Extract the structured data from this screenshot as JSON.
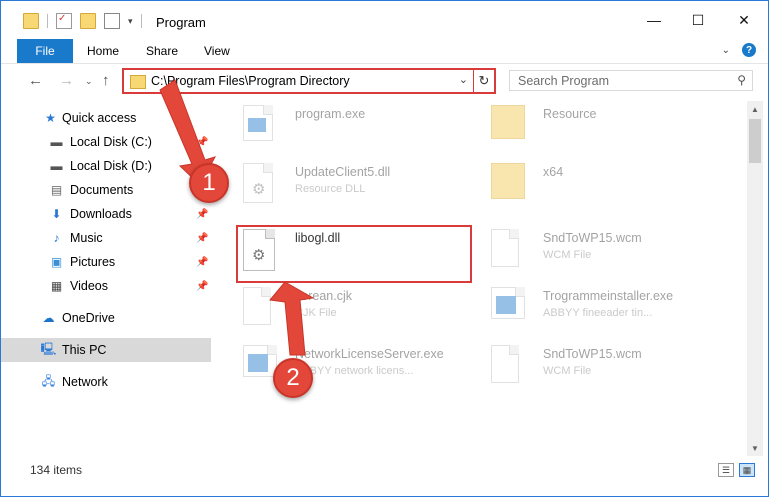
{
  "window": {
    "title": "Program",
    "minimize_label": "—",
    "maximize_label": "☐",
    "close_label": "✕"
  },
  "ribbon": {
    "tabs": [
      "File",
      "Home",
      "Share",
      "View"
    ],
    "help_label": "?"
  },
  "address": {
    "path": "C:\\Program Files\\Program Directory",
    "search_placeholder": "Search Program"
  },
  "nav": {
    "items": [
      {
        "label": "Quick access",
        "icon": "star-icon"
      },
      {
        "label": "Local Disk (C:)",
        "icon": "drive-icon"
      },
      {
        "label": "Local Disk (D:)",
        "icon": "drive-icon"
      },
      {
        "label": "Documents",
        "icon": "documents-icon"
      },
      {
        "label": "Downloads",
        "icon": "download-icon"
      },
      {
        "label": "Music",
        "icon": "music-icon"
      },
      {
        "label": "Pictures",
        "icon": "pictures-icon"
      },
      {
        "label": "Videos",
        "icon": "videos-icon"
      },
      {
        "label": "OneDrive",
        "icon": "cloud-icon"
      },
      {
        "label": "This PC",
        "icon": "computer-icon"
      },
      {
        "label": "Network",
        "icon": "network-icon"
      }
    ]
  },
  "files": [
    {
      "name": "program.exe",
      "sub": ""
    },
    {
      "name": "Resource",
      "sub": ""
    },
    {
      "name": "UpdateClient5.dll",
      "sub": "Resource DLL"
    },
    {
      "name": "x64",
      "sub": ""
    },
    {
      "name": "libogl.dll",
      "sub": ""
    },
    {
      "name": "SndToWP15.wcm",
      "sub": "WCM File"
    },
    {
      "name": "korean.cjk",
      "sub": "CJK File"
    },
    {
      "name": "Trogrammeinstaller.exe",
      "sub": "ABBYY fineeader tin..."
    },
    {
      "name": "NetworkLicenseServer.exe",
      "sub": "ABBYY network licens..."
    },
    {
      "name": "SndToWP15.wcm",
      "sub": "WCM File"
    }
  ],
  "status": {
    "item_count": "134 items"
  },
  "annotations": {
    "badge1": "1",
    "badge2": "2",
    "color": "#e2473a"
  }
}
